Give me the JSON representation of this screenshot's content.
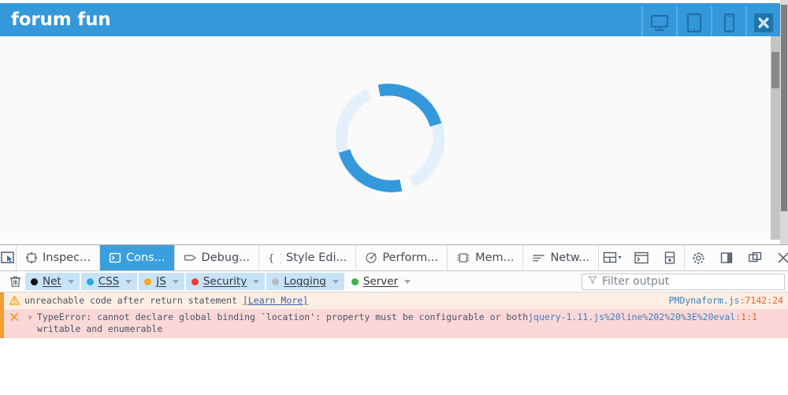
{
  "page": {
    "site_title": "forum fun",
    "header_color": "#3498db",
    "spinner": {
      "name": "loading-spinner",
      "arc_color": "#3498db",
      "track_color": "#e3f0fb"
    },
    "header_buttons": [
      {
        "name": "desktop-view-icon",
        "label": "Desktop view"
      },
      {
        "name": "tablet-view-icon",
        "label": "Tablet view"
      },
      {
        "name": "mobile-view-icon",
        "label": "Mobile view"
      },
      {
        "name": "close-icon",
        "label": "Close"
      }
    ]
  },
  "devtools": {
    "picker": {
      "name": "element-picker-icon",
      "label": "Pick an element from the page"
    },
    "tabs": [
      {
        "label": "Inspec...",
        "icon": "inspector-icon",
        "active": false
      },
      {
        "label": "Cons...",
        "icon": "console-icon",
        "active": true
      },
      {
        "label": "Debug...",
        "icon": "debugger-icon",
        "active": false
      },
      {
        "label": "Style Edi...",
        "icon": "style-editor-icon",
        "active": false
      },
      {
        "label": "Perform...",
        "icon": "performance-icon",
        "active": false
      },
      {
        "label": "Mem...",
        "icon": "memory-icon",
        "active": false
      },
      {
        "label": "Netw...",
        "icon": "network-icon",
        "active": false
      }
    ],
    "tools": [
      {
        "name": "responsive-design-mode-button",
        "label": "Responsive Design Mode"
      },
      {
        "name": "split-console-button",
        "label": "Split console"
      },
      {
        "name": "screenshot-button",
        "label": "Take a screenshot"
      },
      {
        "name": "settings-gear-button",
        "label": "Settings"
      },
      {
        "name": "dock-to-side-button",
        "label": "Dock to side"
      },
      {
        "name": "separate-window-button",
        "label": "Separate window"
      },
      {
        "name": "close-devtools-button",
        "label": "Close DevTools"
      }
    ],
    "filters": {
      "clear_button": {
        "name": "clear-console-button",
        "label": "Clear"
      },
      "buttons": [
        {
          "label": "Net",
          "color": "#111111",
          "active": true
        },
        {
          "label": "CSS",
          "color": "#29abe2",
          "active": true
        },
        {
          "label": "JS",
          "color": "#f5a623",
          "active": true
        },
        {
          "label": "Security",
          "color": "#ee3b3b",
          "active": true
        },
        {
          "label": "Logging",
          "color": "#b6bcc2",
          "active": true
        },
        {
          "label": "Server",
          "color": "#3bb54a",
          "active": false
        }
      ],
      "input": {
        "value": "",
        "placeholder": "Filter output"
      }
    },
    "messages": [
      {
        "level": "warn",
        "icon": "warning-triangle-icon",
        "text": "unreachable code after return statement ",
        "link_text": "[Learn More]",
        "source_file": "PMDynaform.js",
        "source_pos": ":7142:24"
      },
      {
        "level": "error",
        "icon": "error-x-icon",
        "expander": "expand-arrow-icon",
        "text": "TypeError: cannot declare global binding `location': property must be configurable or both",
        "text_line2": "writable and enumerable",
        "source_file": "jquery-1.11.js%20line%202%20%3E%20eval",
        "source_pos": ":1:1"
      }
    ]
  }
}
